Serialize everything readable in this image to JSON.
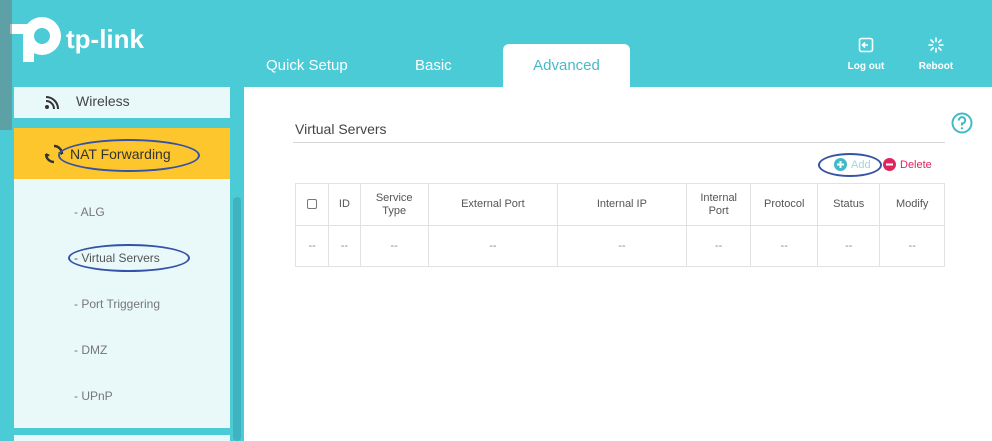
{
  "header": {
    "brand": "tp-link",
    "tabs": [
      {
        "label": "Quick Setup"
      },
      {
        "label": "Basic"
      },
      {
        "label": "Advanced"
      }
    ],
    "buttons": {
      "logout_label": "Log out",
      "reboot_label": "Reboot"
    }
  },
  "sidebar": {
    "wireless_label": "Wireless",
    "nat_label": "NAT Forwarding",
    "sub_items": [
      {
        "label": "- ALG"
      },
      {
        "label": "- Virtual Servers"
      },
      {
        "label": "- Port Triggering"
      },
      {
        "label": "- DMZ"
      },
      {
        "label": "- UPnP"
      }
    ]
  },
  "main": {
    "title": "Virtual Servers",
    "add_label": "Add",
    "delete_label": "Delete",
    "table": {
      "columns": [
        {
          "label": ""
        },
        {
          "label": "ID"
        },
        {
          "label": "Service Type"
        },
        {
          "label": "External Port"
        },
        {
          "label": "Internal IP"
        },
        {
          "label": "Internal Port"
        },
        {
          "label": "Protocol"
        },
        {
          "label": "Status"
        },
        {
          "label": "Modify"
        }
      ],
      "rows": [
        [
          "--",
          "--",
          "--",
          "--",
          "--",
          "--",
          "--",
          "--",
          "--"
        ]
      ]
    }
  },
  "colors": {
    "accent": "#4acbd6",
    "active_nav": "#fdc62c",
    "delete": "#e0245e",
    "annotation": "#3452a6"
  }
}
